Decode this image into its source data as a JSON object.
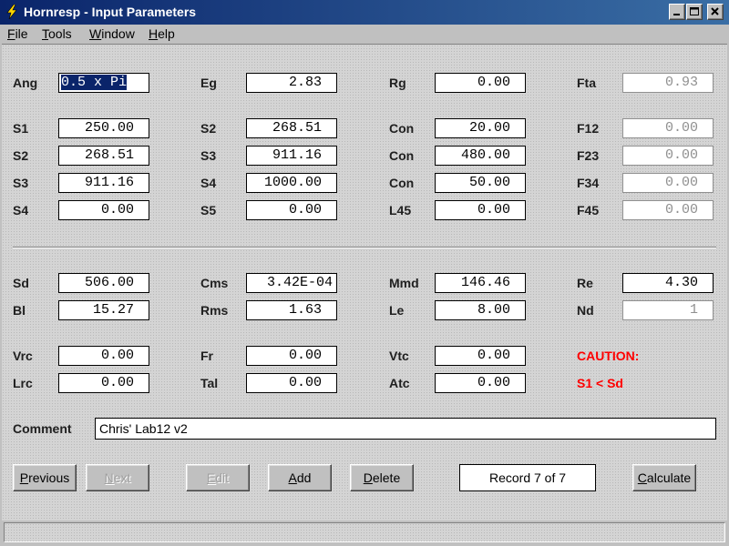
{
  "window": {
    "title": "Hornresp - Input Parameters"
  },
  "menu": [
    {
      "label": "File",
      "accel": "F",
      "rest": "ile"
    },
    {
      "label": "Tools",
      "accel": "T",
      "rest": "ools"
    },
    {
      "label": "Window",
      "accel": "W",
      "rest": "indow"
    },
    {
      "label": "Help",
      "accel": "H",
      "rest": "elp"
    }
  ],
  "params": {
    "col1": [
      {
        "label": "Ang",
        "value": "0.5 x Pi",
        "selected": true
      },
      {
        "label": "S1",
        "value": "250.00"
      },
      {
        "label": "S2",
        "value": "268.51"
      },
      {
        "label": "S3",
        "value": "911.16"
      },
      {
        "label": "S4",
        "value": "0.00"
      }
    ],
    "col2": [
      {
        "label": "Eg",
        "value": "2.83"
      },
      {
        "label": "S2",
        "value": "268.51"
      },
      {
        "label": "S3",
        "value": "911.16"
      },
      {
        "label": "S4",
        "value": "1000.00"
      },
      {
        "label": "S5",
        "value": "0.00"
      }
    ],
    "col3": [
      {
        "label": "Rg",
        "value": "0.00"
      },
      {
        "label": "Con",
        "value": "20.00"
      },
      {
        "label": "Con",
        "value": "480.00"
      },
      {
        "label": "Con",
        "value": "50.00"
      },
      {
        "label": "L45",
        "value": "0.00"
      }
    ],
    "col4": [
      {
        "label": "Fta",
        "value": "0.93"
      },
      {
        "label": "F12",
        "value": "0.00"
      },
      {
        "label": "F23",
        "value": "0.00"
      },
      {
        "label": "F34",
        "value": "0.00"
      },
      {
        "label": "F45",
        "value": "0.00"
      }
    ]
  },
  "driver": {
    "sd": {
      "label": "Sd",
      "value": "506.00"
    },
    "bl": {
      "label": "Bl",
      "value": "15.27"
    },
    "cms": {
      "label": "Cms",
      "value": "3.42E-04"
    },
    "rms": {
      "label": "Rms",
      "value": "1.63"
    },
    "mmd": {
      "label": "Mmd",
      "value": "146.46"
    },
    "le": {
      "label": "Le",
      "value": "8.00"
    },
    "re": {
      "label": "Re",
      "value": "4.30"
    },
    "nd": {
      "label": "Nd",
      "value": "1"
    }
  },
  "chambers": {
    "vrc": {
      "label": "Vrc",
      "value": "0.00"
    },
    "lrc": {
      "label": "Lrc",
      "value": "0.00"
    },
    "fr": {
      "label": "Fr",
      "value": "0.00"
    },
    "tal": {
      "label": "Tal",
      "value": "0.00"
    },
    "vtc": {
      "label": "Vtc",
      "value": "0.00"
    },
    "atc": {
      "label": "Atc",
      "value": "0.00"
    }
  },
  "caution": {
    "title": "CAUTION:",
    "message": "S1 < Sd"
  },
  "comment": {
    "label": "Comment",
    "value": "Chris' Lab12 v2"
  },
  "buttons": {
    "previous": {
      "accel": "P",
      "rest": "revious"
    },
    "next": {
      "accel": "N",
      "rest": "ext"
    },
    "edit": {
      "accel": "E",
      "rest": "dit"
    },
    "add": {
      "accel": "A",
      "rest": "dd"
    },
    "delete": {
      "accel": "D",
      "rest": "elete"
    },
    "calculate": {
      "accel": "C",
      "rest": "alculate"
    }
  },
  "record": "Record 7 of 7",
  "colors": {
    "title_start": "#0a246a",
    "title_end": "#3a6ea5",
    "caution": "#ff0000"
  }
}
